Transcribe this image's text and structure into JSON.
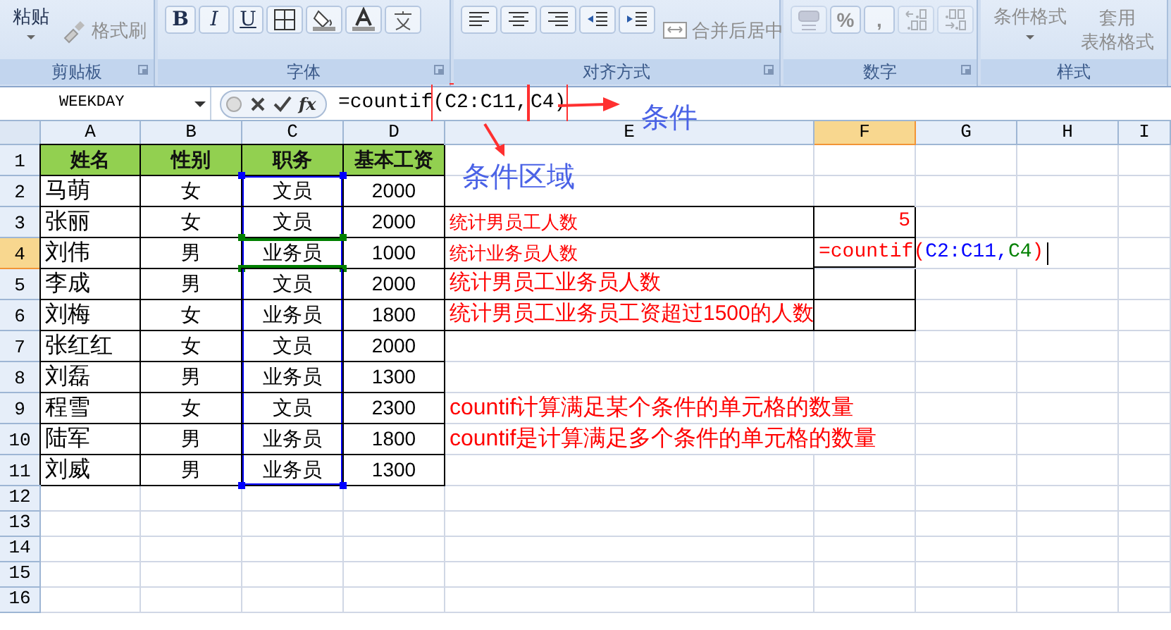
{
  "ribbon": {
    "groups": [
      {
        "label": "剪贴板",
        "items": [
          {
            "kind": "big",
            "text": "粘贴",
            "disabled": false
          },
          {
            "kind": "brush",
            "text": "格式刷",
            "disabled": true
          }
        ]
      },
      {
        "label": "字体",
        "items": [
          {
            "kind": "bold",
            "text": "B",
            "disabled": false
          },
          {
            "kind": "italic",
            "text": "I",
            "disabled": false
          },
          {
            "kind": "underline",
            "text": "U",
            "disabled": false
          },
          {
            "kind": "borders",
            "disabled": false
          },
          {
            "kind": "fill-color",
            "disabled": false
          },
          {
            "kind": "font-color",
            "disabled": false
          },
          {
            "kind": "phonetic",
            "disabled": false
          }
        ]
      },
      {
        "label": "对齐方式",
        "items": [
          {
            "kind": "align-left",
            "disabled": false
          },
          {
            "kind": "align-center",
            "disabled": false
          },
          {
            "kind": "align-right",
            "disabled": false
          },
          {
            "kind": "outdent",
            "disabled": false
          },
          {
            "kind": "indent",
            "disabled": false
          },
          {
            "kind": "merge",
            "text": "合并后居中",
            "disabled": true
          }
        ]
      },
      {
        "label": "数字",
        "items": [
          {
            "kind": "number-format",
            "disabled": true
          },
          {
            "kind": "text",
            "text": "%",
            "disabled": true
          },
          {
            "kind": "text",
            "text": ",",
            "disabled": true
          },
          {
            "kind": "decimal-more",
            "disabled": true
          },
          {
            "kind": "decimal-less",
            "disabled": true
          }
        ]
      },
      {
        "label": "样式",
        "items": [
          {
            "kind": "big",
            "text": "条件格式",
            "disabled": true
          },
          {
            "kind": "stacked",
            "text": "套用",
            "subtext": "表格格式",
            "disabled": true
          }
        ]
      }
    ]
  },
  "formula_bar": {
    "name_box": "WEEKDAY",
    "function_button": "fx",
    "formula": [
      {
        "text": "=countif",
        "boxed": false
      },
      {
        "text": "(C2:C11,",
        "boxed": true
      },
      {
        "text": "C4)",
        "boxed": true
      }
    ]
  },
  "annotations": [
    {
      "text": "条件"
    },
    {
      "text": "条件区域"
    }
  ],
  "columns": [
    {
      "label": "A",
      "selected": false
    },
    {
      "label": "B",
      "selected": false
    },
    {
      "label": "C",
      "selected": false
    },
    {
      "label": "D",
      "selected": false
    },
    {
      "label": "E",
      "selected": false
    },
    {
      "label": "F",
      "selected": true
    },
    {
      "label": "G",
      "selected": false
    },
    {
      "label": "H",
      "selected": false
    },
    {
      "label": "I",
      "selected": false
    }
  ],
  "rows": [
    {
      "label": "1",
      "selected": false,
      "cells": [
        {
          "kind": "header",
          "text": "姓名",
          "boxed": true
        },
        {
          "kind": "header",
          "text": "性别",
          "boxed": true
        },
        {
          "kind": "header",
          "text": "职务",
          "boxed": true
        },
        {
          "kind": "header",
          "text": "基本工资",
          "boxed": true
        },
        {
          "boxed": false
        },
        {
          "boxed": false
        }
      ]
    },
    {
      "label": "2",
      "selected": false,
      "cells": [
        {
          "kind": "name",
          "text": "马萌",
          "boxed": true
        },
        {
          "kind": "value",
          "text": "女",
          "boxed": true
        },
        {
          "kind": "value",
          "text": "文员",
          "boxed": true,
          "in_range": true,
          "active": false
        },
        {
          "kind": "value",
          "text": "2000",
          "boxed": true
        },
        {
          "boxed": false
        },
        {
          "boxed": false
        }
      ]
    },
    {
      "label": "3",
      "selected": false,
      "cells": [
        {
          "kind": "name",
          "text": "张丽",
          "boxed": true
        },
        {
          "kind": "value",
          "text": "女",
          "boxed": true
        },
        {
          "kind": "value",
          "text": "文员",
          "boxed": true,
          "in_range": true,
          "active": false
        },
        {
          "kind": "value",
          "text": "2000",
          "boxed": true
        },
        {
          "kind": "label",
          "text": "统计男员工人数",
          "boxed": true
        },
        {
          "kind": "result",
          "text": "5",
          "boxed": true
        }
      ]
    },
    {
      "label": "4",
      "selected": true,
      "cells": [
        {
          "kind": "name",
          "text": "刘伟",
          "boxed": true
        },
        {
          "kind": "value",
          "text": "男",
          "boxed": true
        },
        {
          "kind": "value",
          "text": "业务员",
          "boxed": true,
          "in_range": true,
          "active": true
        },
        {
          "kind": "value",
          "text": "1000",
          "boxed": true
        },
        {
          "kind": "label",
          "text": "统计业务员人数",
          "boxed": true
        },
        {
          "kind": "editing",
          "boxed": true,
          "segments": [
            {
              "text": "=countif(",
              "color": "#ff0000"
            },
            {
              "text": "C2:C11",
              "color": "#0000ff"
            },
            {
              "text": ",",
              "color": "#0000ff"
            },
            {
              "text": "C4",
              "color": "#008000"
            },
            {
              "text": ")",
              "color": "#ff0000"
            }
          ]
        }
      ]
    },
    {
      "label": "5",
      "selected": false,
      "cells": [
        {
          "kind": "name",
          "text": "李成",
          "boxed": true
        },
        {
          "kind": "value",
          "text": "男",
          "boxed": true
        },
        {
          "kind": "value",
          "text": "文员",
          "boxed": true,
          "in_range": true,
          "active": false
        },
        {
          "kind": "value",
          "text": "2000",
          "boxed": true
        },
        {
          "kind": "label-large",
          "text": "统计男员工业务员人数",
          "boxed": true
        },
        {
          "boxed": true
        }
      ]
    },
    {
      "label": "6",
      "selected": false,
      "cells": [
        {
          "kind": "name",
          "text": "刘梅",
          "boxed": true
        },
        {
          "kind": "value",
          "text": "女",
          "boxed": true
        },
        {
          "kind": "value",
          "text": "业务员",
          "boxed": true,
          "in_range": true,
          "active": false
        },
        {
          "kind": "value",
          "text": "1800",
          "boxed": true
        },
        {
          "kind": "label-large",
          "text": "统计男员工业务员工资超过1500的人数",
          "boxed": true
        },
        {
          "boxed": true
        }
      ]
    },
    {
      "label": "7",
      "selected": false,
      "cells": [
        {
          "kind": "name",
          "text": "张红红",
          "boxed": true
        },
        {
          "kind": "value",
          "text": "女",
          "boxed": true
        },
        {
          "kind": "value",
          "text": "文员",
          "boxed": true,
          "in_range": true,
          "active": false
        },
        {
          "kind": "value",
          "text": "2000",
          "boxed": true
        },
        {
          "boxed": false
        },
        {
          "boxed": false
        }
      ]
    },
    {
      "label": "8",
      "selected": false,
      "cells": [
        {
          "kind": "name",
          "text": "刘磊",
          "boxed": true
        },
        {
          "kind": "value",
          "text": "男",
          "boxed": true
        },
        {
          "kind": "value",
          "text": "业务员",
          "boxed": true,
          "in_range": true,
          "active": false
        },
        {
          "kind": "value",
          "text": "1300",
          "boxed": true
        },
        {
          "boxed": false
        },
        {
          "boxed": false
        }
      ]
    },
    {
      "label": "9",
      "selected": false,
      "cells": [
        {
          "kind": "name",
          "text": "程雪",
          "boxed": true
        },
        {
          "kind": "value",
          "text": "女",
          "boxed": true
        },
        {
          "kind": "value",
          "text": "文员",
          "boxed": true,
          "in_range": true,
          "active": false
        },
        {
          "kind": "value",
          "text": "2300",
          "boxed": true
        },
        {
          "kind": "note",
          "text": "countif计算满足某个条件的单元格的数量",
          "boxed": false
        }
      ]
    },
    {
      "label": "10",
      "selected": false,
      "cells": [
        {
          "kind": "name",
          "text": "陆军",
          "boxed": true
        },
        {
          "kind": "value",
          "text": "男",
          "boxed": true
        },
        {
          "kind": "value",
          "text": "业务员",
          "boxed": true,
          "in_range": true,
          "active": false
        },
        {
          "kind": "value",
          "text": "1800",
          "boxed": true
        },
        {
          "kind": "note",
          "text": "countif是计算满足多个条件的单元格的数量",
          "boxed": false
        }
      ]
    },
    {
      "label": "11",
      "selected": false,
      "cells": [
        {
          "kind": "name",
          "text": "刘威",
          "boxed": true
        },
        {
          "kind": "value",
          "text": "男",
          "boxed": true
        },
        {
          "kind": "value",
          "text": "业务员",
          "boxed": true,
          "in_range": true,
          "active": false
        },
        {
          "kind": "value",
          "text": "1300",
          "boxed": true
        },
        {
          "boxed": false
        },
        {
          "boxed": false
        }
      ]
    },
    {
      "label": "12",
      "selected": false,
      "cells": []
    },
    {
      "label": "13",
      "selected": false,
      "cells": []
    },
    {
      "label": "14",
      "selected": false,
      "cells": []
    },
    {
      "label": "15",
      "selected": false,
      "cells": []
    },
    {
      "label": "16",
      "selected": false,
      "cells": []
    }
  ]
}
